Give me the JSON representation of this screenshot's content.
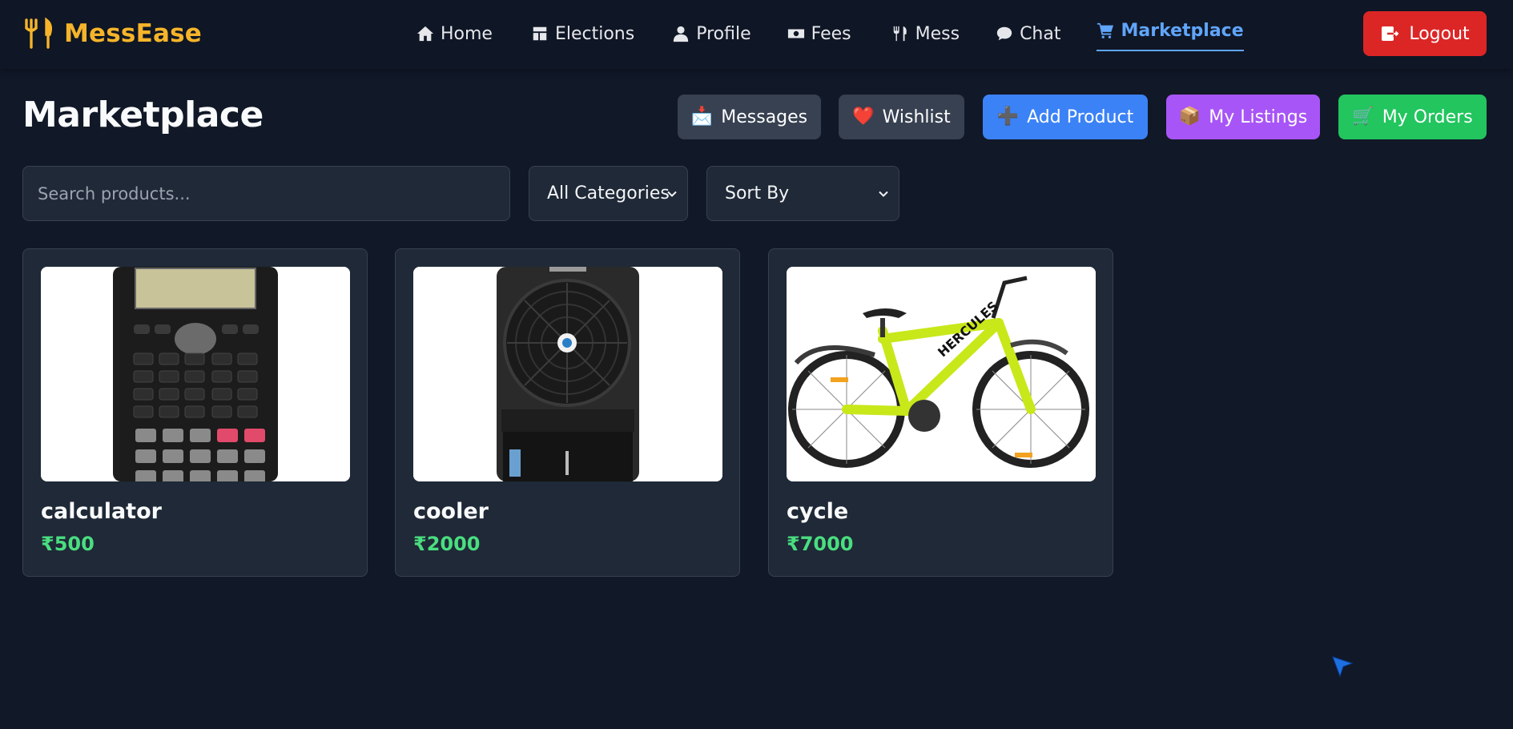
{
  "brand": {
    "name": "MessEase",
    "icon": "fork-knife-icon",
    "color": "#f6b42a"
  },
  "nav": {
    "items": [
      {
        "label": "Home",
        "icon": "home-icon"
      },
      {
        "label": "Elections",
        "icon": "elections-icon"
      },
      {
        "label": "Profile",
        "icon": "user-icon"
      },
      {
        "label": "Fees",
        "icon": "money-icon"
      },
      {
        "label": "Mess",
        "icon": "fork-knife-icon"
      },
      {
        "label": "Chat",
        "icon": "chat-bubble-icon"
      },
      {
        "label": "Marketplace",
        "icon": "cart-icon",
        "active": true
      }
    ],
    "logout_label": "Logout",
    "active_color": "#60a5fa"
  },
  "page": {
    "title": "Marketplace"
  },
  "actions": {
    "messages": {
      "label": "Messages",
      "icon": "📩"
    },
    "wishlist": {
      "label": "Wishlist",
      "icon": "❤️"
    },
    "add_product": {
      "label": "Add Product",
      "icon": "➕"
    },
    "my_listings": {
      "label": "My Listings",
      "icon": "📦"
    },
    "my_orders": {
      "label": "My Orders",
      "icon": "🛒"
    }
  },
  "filters": {
    "search_placeholder": "Search products...",
    "category_selected": "All Categories",
    "sort_selected": "Sort By"
  },
  "products": [
    {
      "name": "calculator",
      "price": "₹500",
      "image": "calculator-image"
    },
    {
      "name": "cooler",
      "price": "₹2000",
      "image": "cooler-image"
    },
    {
      "name": "cycle",
      "price": "₹7000",
      "image": "cycle-image"
    }
  ],
  "colors": {
    "background": "#111827",
    "card": "#1f2937",
    "price": "#4ade80",
    "add_product": "#3b82f6",
    "my_listings": "#a855f7",
    "my_orders": "#22c55e",
    "logout": "#dc2626"
  }
}
